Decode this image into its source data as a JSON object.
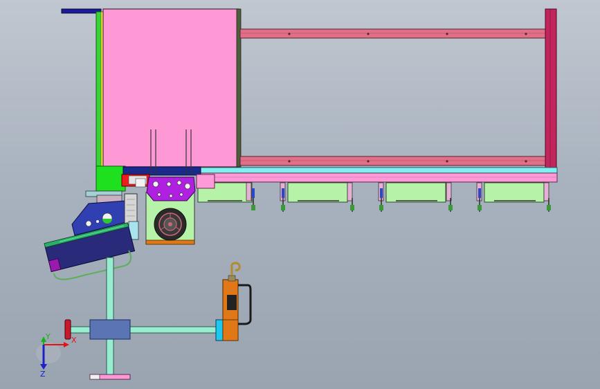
{
  "viewport": {
    "background_top": "#c0c7d0",
    "background_bottom": "#9aa4b1"
  },
  "triad": {
    "x_label": "X",
    "y_label": "Y",
    "z_label": "Z",
    "x_color": "#e81010",
    "y_color": "#18b018",
    "z_color": "#1a22c8"
  },
  "colors": {
    "panel_pink": "#ff99d6",
    "rail_pink": "#e06f88",
    "post_crimson": "#c2255c",
    "cyan_bar": "#80f0f0",
    "light_green": "#b6f2a8",
    "purple": "#b020e0",
    "tube_green": "#98ecd0",
    "orange": "#e07818",
    "steel_blue": "#5a74b4"
  }
}
